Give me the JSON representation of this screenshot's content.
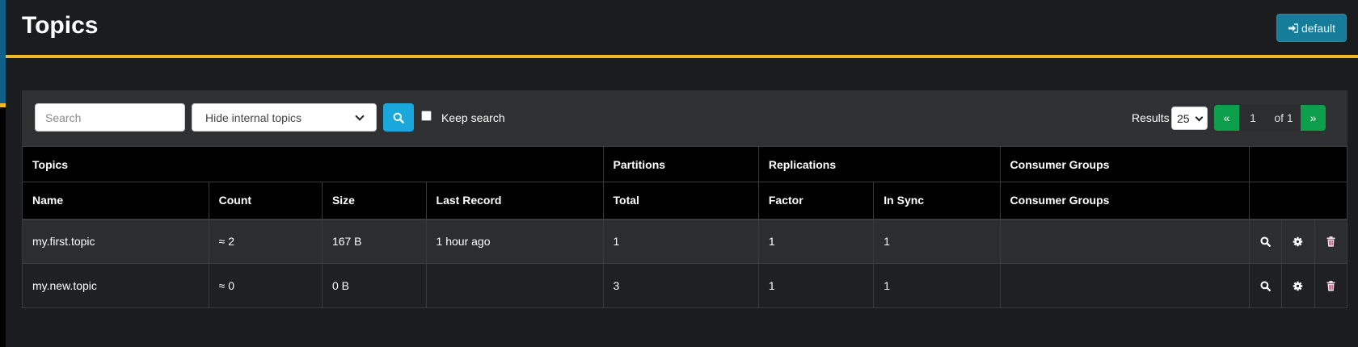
{
  "header": {
    "title": "Topics",
    "cluster_button": "default"
  },
  "toolbar": {
    "search_placeholder": "Search",
    "filter_value": "Hide internal topics",
    "keep_search_label": "Keep search",
    "results_label": "Results",
    "results_per_page": "25",
    "pagination": {
      "prev": "«",
      "page": "1",
      "of": "of 1",
      "next": "»"
    }
  },
  "table": {
    "group_headers": {
      "topics": "Topics",
      "partitions": "Partitions",
      "replications": "Replications",
      "consumer_groups": "Consumer Groups"
    },
    "columns": {
      "name": "Name",
      "count": "Count",
      "size": "Size",
      "last_record": "Last Record",
      "total": "Total",
      "factor": "Factor",
      "in_sync": "In Sync",
      "consumer_groups": "Consumer Groups"
    },
    "rows": [
      {
        "name": "my.first.topic",
        "count": "≈ 2",
        "size": "167 B",
        "last_record": "1 hour ago",
        "total": "1",
        "factor": "1",
        "in_sync": "1",
        "consumer_groups": ""
      },
      {
        "name": "my.new.topic",
        "count": "≈ 0",
        "size": "0 B",
        "last_record": "",
        "total": "3",
        "factor": "1",
        "in_sync": "1",
        "consumer_groups": ""
      }
    ],
    "row_actions": [
      "search-icon",
      "gear-icon",
      "trash-icon"
    ]
  },
  "colors": {
    "accent_gold": "#f0b82a",
    "cluster_button": "#157c99",
    "search_button": "#1aa8dc",
    "pager_green": "#0e9f4c",
    "delete_icon": "#f7d9e6"
  }
}
